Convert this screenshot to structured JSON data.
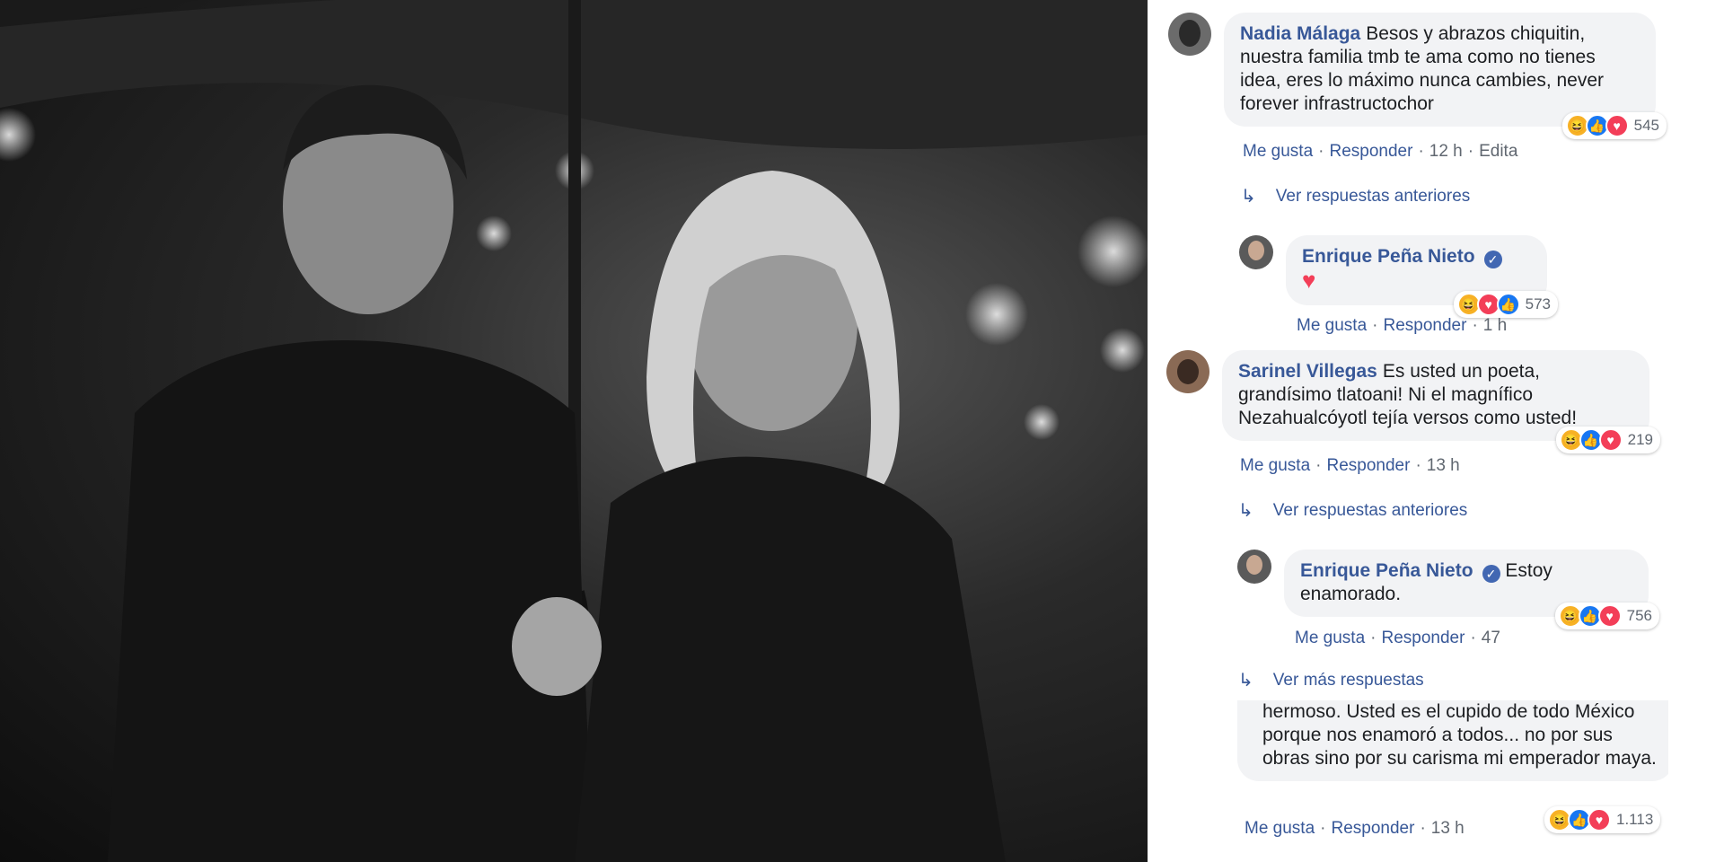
{
  "comments": [
    {
      "author": "Nadia Málaga",
      "text": "Besos y abrazos chiquitin, nuestra familia tmb te ama como no tienes idea, eres lo máximo nunca cambies, never forever infrastructochor",
      "like": "Me gusta",
      "reply": "Responder",
      "time": "12 h",
      "edited": "Edita",
      "reaction_count": "545",
      "reactions": [
        "haha-icon",
        "like-icon",
        "love-icon"
      ]
    },
    {
      "author": "Enrique Peña Nieto",
      "text": "",
      "like": "Me gusta",
      "reply": "Responder",
      "time": "1 h",
      "reaction_count": "573",
      "reactions": [
        "haha-icon",
        "love-icon",
        "like-icon"
      ]
    },
    {
      "author": "Sarinel Villegas",
      "text": "Es usted un poeta, grandísimo tlatoani! Ni el magnífico Nezahualcóyotl tejía versos como usted!",
      "like": "Me gusta",
      "reply": "Responder",
      "time": "13 h",
      "reaction_count": "219",
      "reactions": [
        "haha-icon",
        "like-icon",
        "love-icon"
      ]
    },
    {
      "author": "Enrique Peña Nieto",
      "text": "Estoy enamorado.",
      "like": "Me gusta",
      "reply": "Responder",
      "time": "47",
      "reaction_count": "756",
      "reactions": [
        "haha-icon",
        "like-icon",
        "love-icon"
      ]
    },
    {
      "text": "hermoso. Usted es el cupido de todo México porque nos enamoró a todos... no por sus obras sino por su carisma mi emperador maya.",
      "like": "Me gusta",
      "reply": "Responder",
      "time": "13 h",
      "reaction_count": "1.113",
      "reactions": [
        "haha-icon",
        "like-icon",
        "love-icon"
      ]
    }
  ],
  "see_previous": "Ver respuestas anteriores",
  "see_more": "Ver más respuestas",
  "verified_icon": "verified-badge-icon",
  "colors": {
    "link": "#385898",
    "bubble": "#f2f3f5",
    "like": "#1877f2",
    "love": "#f33e58",
    "haha": "#f7b125"
  }
}
